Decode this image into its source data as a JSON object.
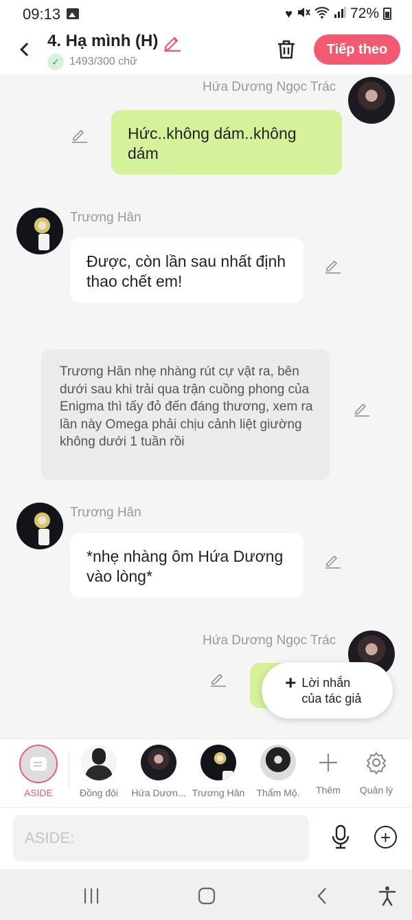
{
  "status_bar": {
    "time": "09:13",
    "battery": "72%"
  },
  "header": {
    "title": "4. Hạ mình (H)",
    "word_count": "1493/300 chữ",
    "next_label": "Tiếp theo"
  },
  "messages": [
    {
      "sender": "Hứa Dương Ngọc Trác",
      "text": "Hức..không dám..không dám"
    },
    {
      "sender": "Trương Hân",
      "text": "Được, còn lần sau nhất định thao chết em!"
    },
    {
      "text": "Trương Hân nhẹ nhàng rút cự vật ra, bên dưới sau khi trải qua trận cuồng phong của Enigma thì tấy đỏ đến đáng thương, xem ra lần này Omega phải chịu cảnh liệt giường không dưới 1 tuần rồi"
    },
    {
      "sender": "Trương Hân",
      "text": "*nhẹ nhàng ôm Hứa Dương vào lòng*"
    },
    {
      "sender": "Hứa Dương Ngọc Trác"
    }
  ],
  "author_note": "Lời nhắn của tác giả",
  "characters": {
    "aside": "ASIDE",
    "teammates": "Đồng đội",
    "char1": "Hứa Dươn...",
    "char2": "Trương Hân",
    "char3": "Thẩm Mộ.",
    "add": "Thêm",
    "manage": "Quản lý"
  },
  "input": {
    "placeholder": "ASIDE:"
  },
  "colors": {
    "accent": "#f25a72",
    "user_bubble": "#d5f29a",
    "char_bubble": "#ffffff",
    "narration_bubble": "#ebebeb"
  }
}
